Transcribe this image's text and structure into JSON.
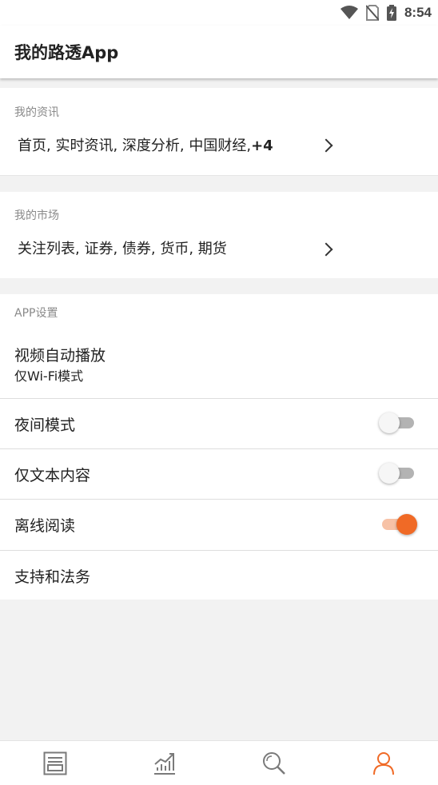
{
  "status_bar": {
    "time": "8:54",
    "icons": [
      "wifi-icon",
      "no-sim-icon",
      "battery-charging-icon"
    ]
  },
  "app_bar": {
    "title": "我的路透App"
  },
  "my_news": {
    "label": "我的资讯",
    "value_text": "首页, 实时资讯, 深度分析, 中国财经,",
    "more_count": "+4"
  },
  "my_markets": {
    "label": "我的市场",
    "value_text": "关注列表, 证券, 债券, 货币, 期货"
  },
  "app_settings": {
    "label": "APP设置",
    "video_autoplay": {
      "title": "视频自动播放",
      "value": "仅Wi-Fi模式"
    },
    "night_mode": {
      "title": "夜间模式",
      "enabled": false
    },
    "text_only": {
      "title": "仅文本内容",
      "enabled": false
    },
    "offline_reading": {
      "title": "离线阅读",
      "enabled": true
    },
    "support_legal": {
      "title": "支持和法务"
    }
  },
  "colors": {
    "accent": "#f06a26",
    "accent_light": "#f7c2a6"
  },
  "bottom_nav": {
    "items": [
      {
        "icon": "news-icon",
        "active": false
      },
      {
        "icon": "markets-chart-icon",
        "active": false
      },
      {
        "icon": "search-icon",
        "active": false
      },
      {
        "icon": "profile-icon",
        "active": true
      }
    ]
  }
}
